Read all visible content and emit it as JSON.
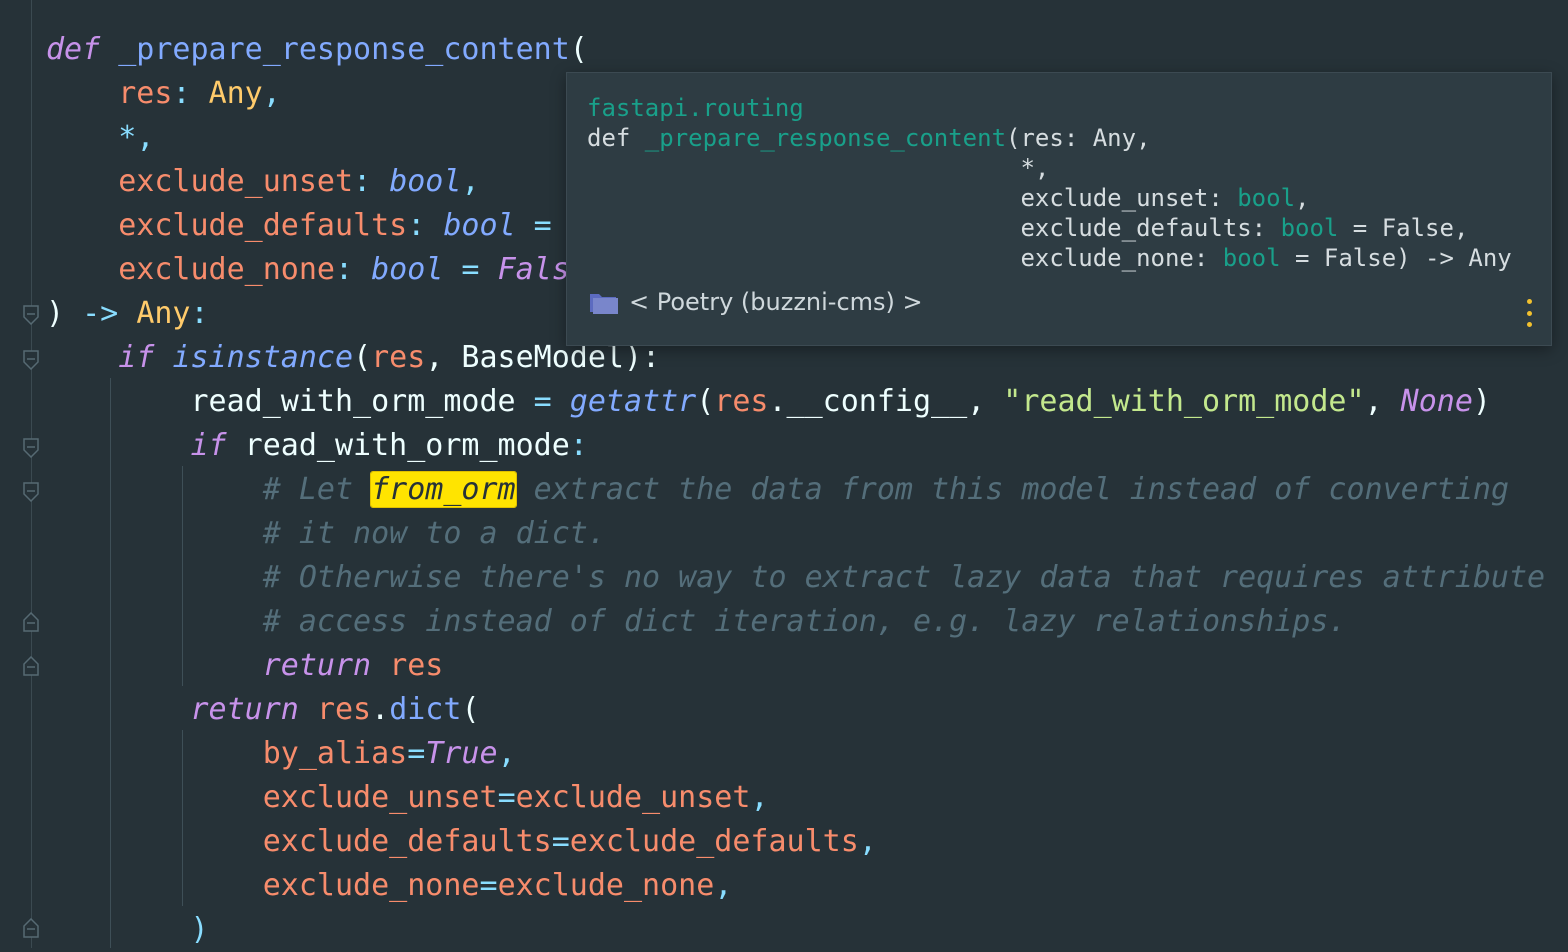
{
  "colors": {
    "background": "#263238",
    "keyword": "#c792ea",
    "function": "#82aaff",
    "parameter": "#f78c6c",
    "type": "#ffcb6b",
    "string": "#c3e88d",
    "comment": "#546e7a",
    "highlight": "#ffe400",
    "popup_accent": "#19a08a"
  },
  "code": {
    "l1": {
      "kw": "def",
      "fn": " _prepare_response_content",
      "p": "("
    },
    "l2": {
      "ind": "    ",
      "param": "res",
      "colon": ": ",
      "type": "Any",
      "comma": ","
    },
    "l3": {
      "ind": "    ",
      "star": "*",
      "comma": ","
    },
    "l4": {
      "ind": "    ",
      "param": "exclude_unset",
      "colon": ": ",
      "type": "bool",
      "comma": ","
    },
    "l5": {
      "ind": "    ",
      "param": "exclude_defaults",
      "colon": ": ",
      "type": "bool",
      "eq": " = "
    },
    "l6": {
      "ind": "    ",
      "param": "exclude_none",
      "colon": ": ",
      "type": "bool",
      "eq": " = ",
      "val": "Fals"
    },
    "l7": {
      "close": ") ",
      "arrow": "->",
      "sp": " ",
      "type": "Any",
      "colon": ":"
    },
    "l8": {
      "ind": "    ",
      "kw": "if",
      "sp": " ",
      "fn": "isinstance",
      "p1": "(",
      "param": "res",
      "rest": ", BaseModel",
      "p2": "):"
    },
    "l9": {
      "ind": "        ",
      "var": "read_with_orm_mode",
      "eq": " = ",
      "fn": "getattr",
      "p1": "(",
      "param": "res",
      "attr": ".__config__, ",
      "str": "\"read_with_orm_mode\"",
      "comma": ", ",
      "none": "None",
      "p2": ")"
    },
    "l10": {
      "ind": "        ",
      "kw": "if",
      "rest": " read_with_orm_mode",
      "colon": ":"
    },
    "l11": {
      "ind": "            ",
      "c1": "# Let ",
      "hl": "from_orm",
      "c2": " extract the data from this model instead of converting"
    },
    "l12": {
      "ind": "            ",
      "c": "# it now to a dict."
    },
    "l13": {
      "ind": "            ",
      "c": "# Otherwise there's no way to extract lazy data that requires attribute"
    },
    "l14": {
      "ind": "            ",
      "c": "# access instead of dict iteration, e.g. lazy relationships."
    },
    "l15": {
      "ind": "            ",
      "kw": "return",
      "sp": " ",
      "param": "res"
    },
    "l16": {
      "ind": "        ",
      "kw": "return",
      "sp": " ",
      "param": "res",
      "dot": ".",
      "fn": "dict",
      "p": "("
    },
    "l17": {
      "ind": "            ",
      "param": "by_alias",
      "eq": "=",
      "bool": "True",
      "comma": ","
    },
    "l18": {
      "ind": "            ",
      "param": "exclude_unset",
      "eq": "=",
      "val": "exclude_unset",
      "comma": ","
    },
    "l19": {
      "ind": "            ",
      "param": "exclude_defaults",
      "eq": "=",
      "val": "exclude_defaults",
      "comma": ","
    },
    "l20": {
      "ind": "            ",
      "param": "exclude_none",
      "eq": "=",
      "val": "exclude_none",
      "comma": ","
    },
    "l21": {
      "ind": "        ",
      "p": ")"
    }
  },
  "popup": {
    "module": "fastapi.routing",
    "sig1_def": "def ",
    "sig1_fn": "_prepare_response_content",
    "sig1_rest": "(res: Any,",
    "sig2": "                              *,",
    "sig3_a": "                              exclude_unset: ",
    "sig3_t": "bool",
    "sig3_b": ",",
    "sig4_a": "                              exclude_defaults: ",
    "sig4_t": "bool",
    "sig4_b": " = False,",
    "sig5_a": "                              exclude_none: ",
    "sig5_t": "bool",
    "sig5_b": " = False) -> Any",
    "environment": "< Poetry (buzzni-cms) >",
    "folder_icon": "folder-icon",
    "more_icon": "more-vertical-icon"
  }
}
